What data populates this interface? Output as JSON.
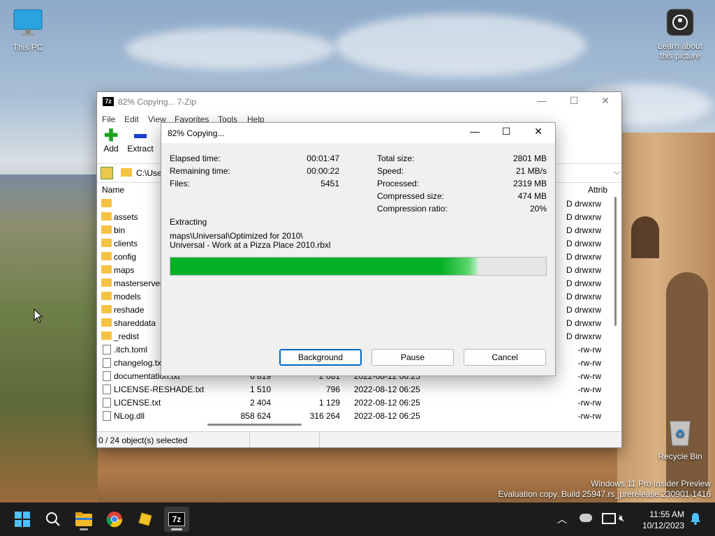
{
  "desktop": {
    "icons": [
      {
        "label": "This PC",
        "icon": "monitor-icon"
      },
      {
        "label": "Learn about\nthis picture",
        "icon": "camera-icon"
      },
      {
        "label": "Recycle Bin",
        "icon": "recycle-bin-icon"
      }
    ],
    "watermark": {
      "line1": "Windows 11 Pro Insider Preview",
      "line2": "Evaluation copy. Build 25947.rs_prerelease.230901-1416"
    }
  },
  "main_window": {
    "title": "82% Copying... 7-Zip",
    "app_icon_text": "7z",
    "menu": [
      "File",
      "Edit",
      "View",
      "Favorites",
      "Tools",
      "Help"
    ],
    "toolbar": {
      "add_label": "Add",
      "extract_label": "Extract"
    },
    "address": "C:\\Use",
    "columns": {
      "name": "Name",
      "attrib": "Attrib"
    },
    "rows": [
      {
        "name": "",
        "type": "folder",
        "size": "",
        "packed": "",
        "modified": "",
        "attrib": "D drwxrw"
      },
      {
        "name": "assets",
        "type": "folder",
        "size": "",
        "packed": "",
        "modified": "",
        "attrib": "D drwxrw"
      },
      {
        "name": "bin",
        "type": "folder",
        "size": "",
        "packed": "",
        "modified": "",
        "attrib": "D drwxrw"
      },
      {
        "name": "clients",
        "type": "folder",
        "size": "",
        "packed": "",
        "modified": "",
        "attrib": "D drwxrw"
      },
      {
        "name": "config",
        "type": "folder",
        "size": "",
        "packed": "",
        "modified": "",
        "attrib": "D drwxrw"
      },
      {
        "name": "maps",
        "type": "folder",
        "size": "",
        "packed": "",
        "modified": "",
        "attrib": "D drwxrw"
      },
      {
        "name": "masterserver",
        "type": "folder",
        "size": "",
        "packed": "",
        "modified": "",
        "attrib": "D drwxrw"
      },
      {
        "name": "models",
        "type": "folder",
        "size": "",
        "packed": "",
        "modified": "",
        "attrib": "D drwxrw"
      },
      {
        "name": "reshade",
        "type": "folder",
        "size": "",
        "packed": "",
        "modified": "",
        "attrib": "D drwxrw"
      },
      {
        "name": "shareddata",
        "type": "folder",
        "size": "",
        "packed": "",
        "modified": "",
        "attrib": "D drwxrw"
      },
      {
        "name": "_redist",
        "type": "folder",
        "size": "",
        "packed": "",
        "modified": "",
        "attrib": "D drwxrw"
      },
      {
        "name": ".itch.toml",
        "type": "file",
        "size": "",
        "packed": "",
        "modified": "",
        "attrib": "-rw-rw"
      },
      {
        "name": "changelog.tx",
        "type": "file",
        "size": "",
        "packed": "",
        "modified": "",
        "attrib": "-rw-rw"
      },
      {
        "name": "documentation.txt",
        "type": "file",
        "size": "6 819",
        "packed": "2 081",
        "modified": "2022-08-12 06:25",
        "attrib": "-rw-rw"
      },
      {
        "name": "LICENSE-RESHADE.txt",
        "type": "file",
        "size": "1 510",
        "packed": "796",
        "modified": "2022-08-12 06:25",
        "attrib": "-rw-rw"
      },
      {
        "name": "LICENSE.txt",
        "type": "file",
        "size": "2 404",
        "packed": "1 129",
        "modified": "2022-08-12 06:25",
        "attrib": "-rw-rw"
      },
      {
        "name": "NLog.dll",
        "type": "file",
        "size": "858 624",
        "packed": "316 264",
        "modified": "2022-08-12 06:25",
        "attrib": "-rw-rw"
      }
    ],
    "status": "0 / 24 object(s) selected"
  },
  "dialog": {
    "title": "82% Copying...",
    "elapsed_label": "Elapsed time:",
    "elapsed": "00:01:47",
    "remaining_label": "Remaining time:",
    "remaining": "00:00:22",
    "files_label": "Files:",
    "files": "5451",
    "total_label": "Total size:",
    "total": "2801 MB",
    "speed_label": "Speed:",
    "speed": "21 MB/s",
    "processed_label": "Processed:",
    "processed": "2319 MB",
    "compressed_label": "Compressed size:",
    "compressed": "474 MB",
    "ratio_label": "Compression ratio:",
    "ratio": "20%",
    "operation": "Extracting",
    "path_line1": "maps\\Universal\\Optimized for 2010\\",
    "path_line2": "Universal - Work at a Pizza Place 2010.rbxl",
    "progress": 0.82,
    "buttons": {
      "background": "Background",
      "pause": "Pause",
      "cancel": "Cancel"
    }
  },
  "taskbar": {
    "time": "11:55 AM",
    "date": "10/12/2023",
    "apps": [
      "start-icon",
      "search-icon",
      "file-explorer-icon",
      "chrome-icon",
      "sticky-app-icon",
      "7zip-icon"
    ]
  },
  "colors": {
    "progress_green": "#06b025",
    "accent": "#0067c0",
    "taskbar": "#1c1c1c"
  }
}
